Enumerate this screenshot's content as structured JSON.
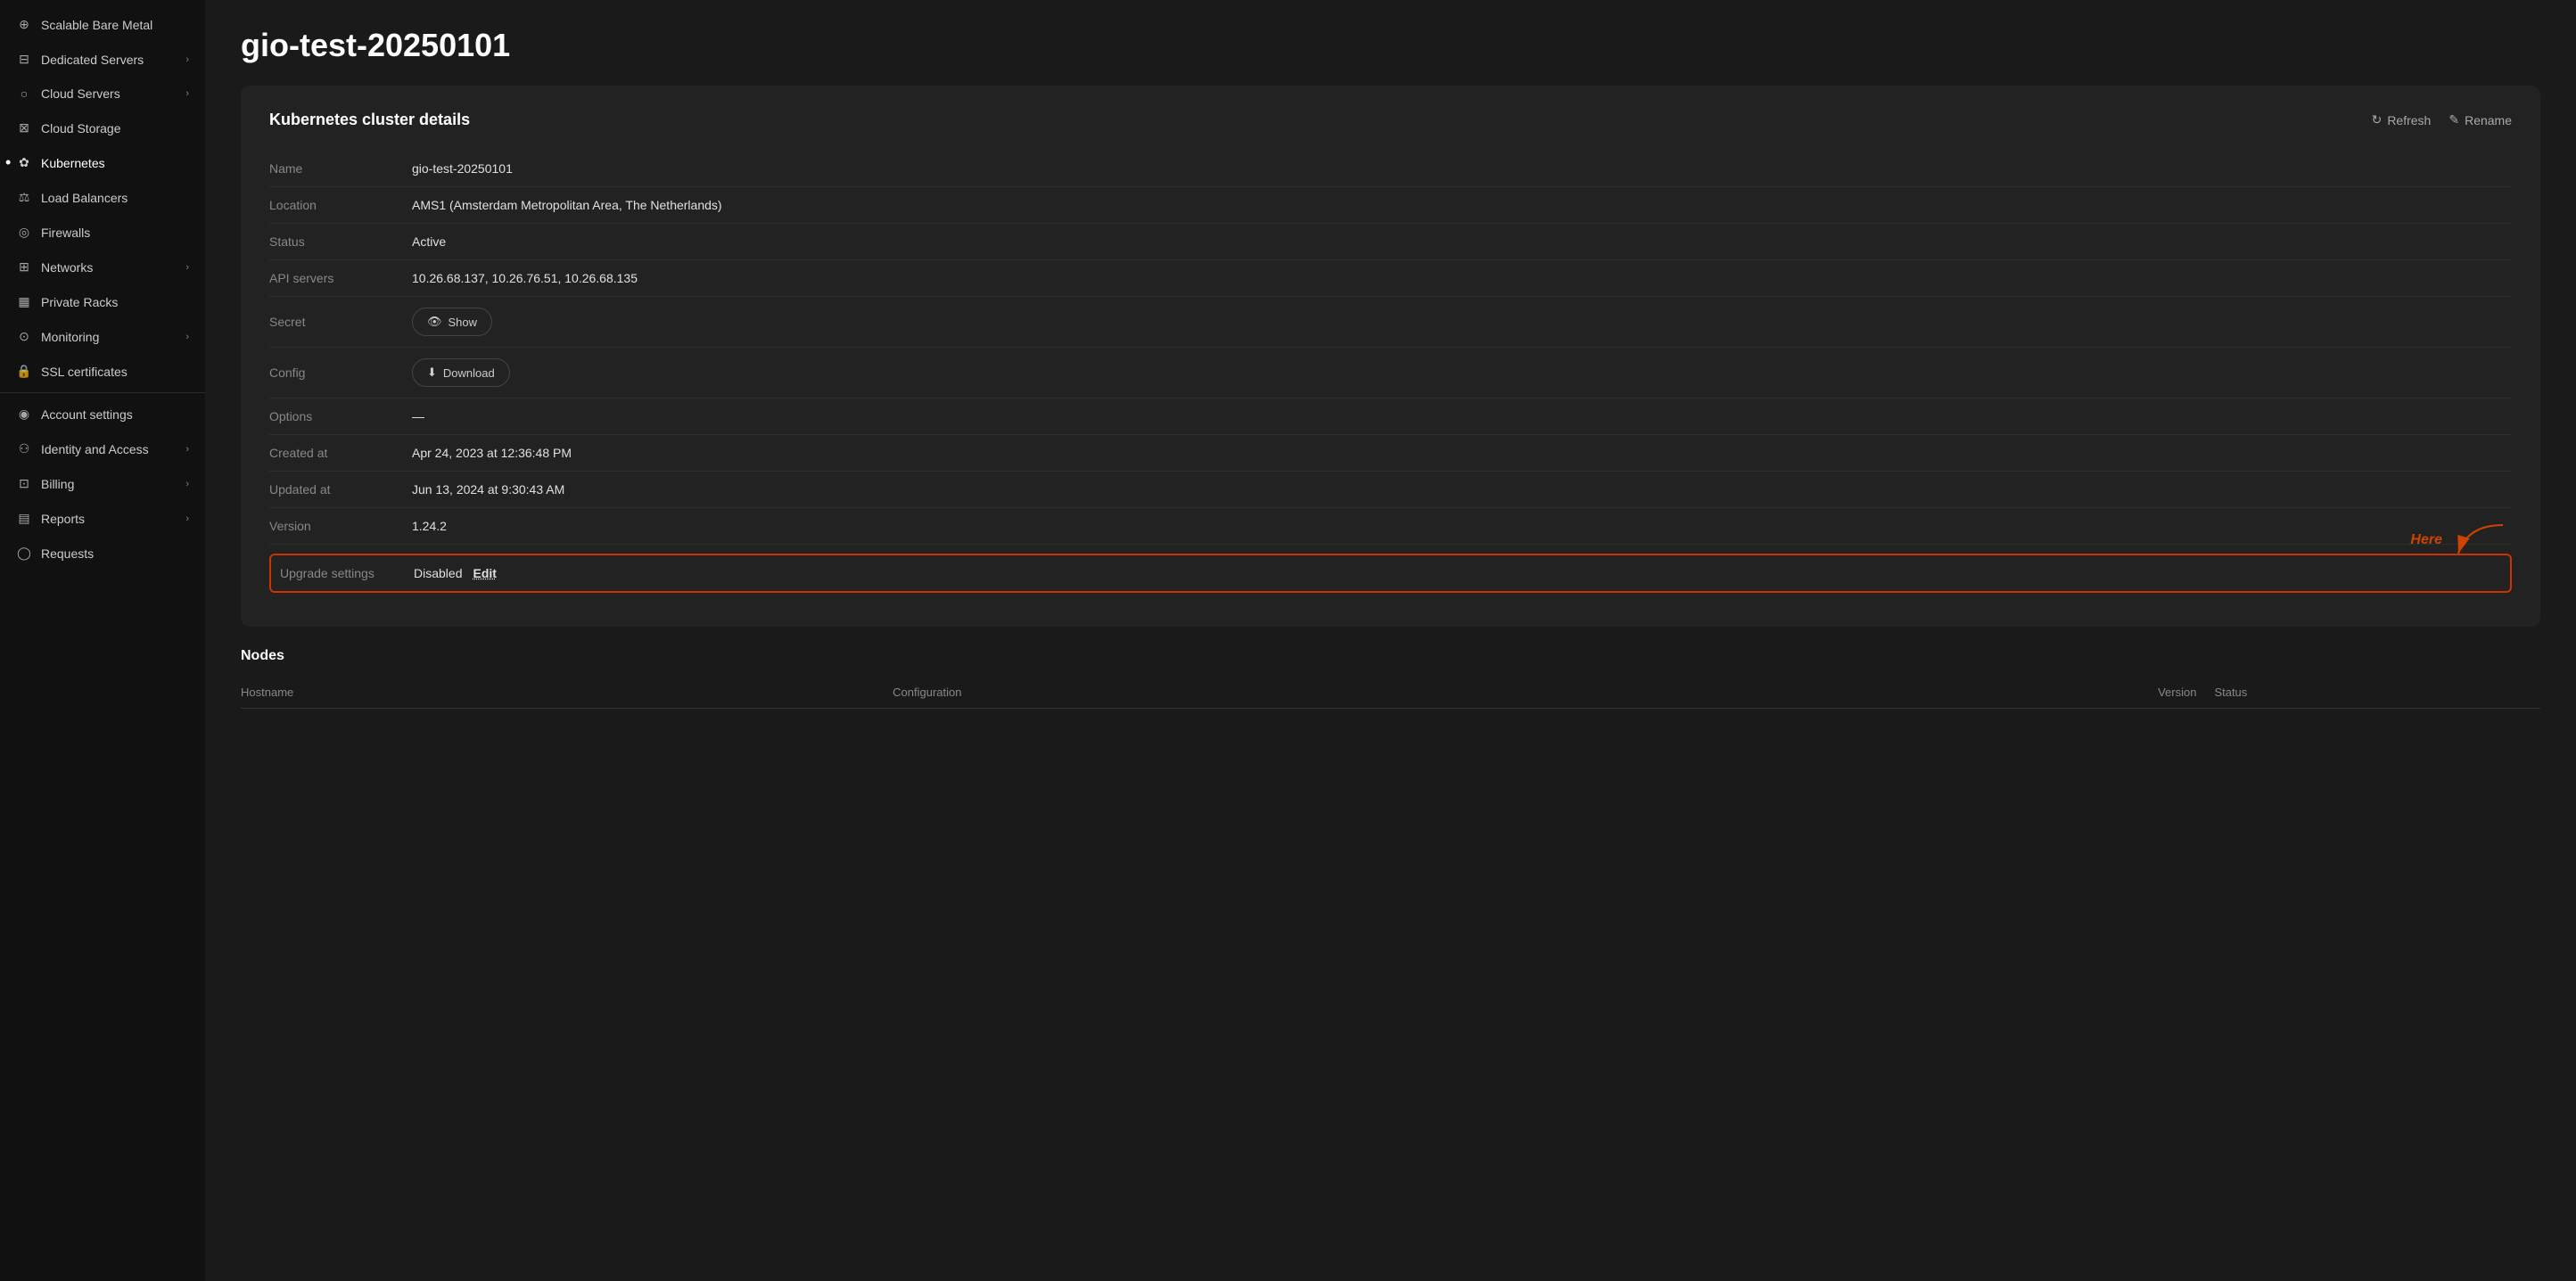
{
  "sidebar": {
    "items": [
      {
        "id": "scalable-bare-metal",
        "label": "Scalable Bare Metal",
        "icon": "⊕",
        "hasChevron": false,
        "active": false
      },
      {
        "id": "dedicated-servers",
        "label": "Dedicated Servers",
        "icon": "⊟",
        "hasChevron": true,
        "active": false
      },
      {
        "id": "cloud-servers",
        "label": "Cloud Servers",
        "icon": "○",
        "hasChevron": true,
        "active": false
      },
      {
        "id": "cloud-storage",
        "label": "Cloud Storage",
        "icon": "⊠",
        "hasChevron": false,
        "active": false
      },
      {
        "id": "kubernetes",
        "label": "Kubernetes",
        "icon": "✿",
        "hasChevron": false,
        "active": true
      },
      {
        "id": "load-balancers",
        "label": "Load Balancers",
        "icon": "⚖",
        "hasChevron": false,
        "active": false
      },
      {
        "id": "firewalls",
        "label": "Firewalls",
        "icon": "◎",
        "hasChevron": false,
        "active": false
      },
      {
        "id": "networks",
        "label": "Networks",
        "icon": "⊞",
        "hasChevron": true,
        "active": false
      },
      {
        "id": "private-racks",
        "label": "Private Racks",
        "icon": "▦",
        "hasChevron": false,
        "active": false
      },
      {
        "id": "monitoring",
        "label": "Monitoring",
        "icon": "⊙",
        "hasChevron": true,
        "active": false
      },
      {
        "id": "ssl-certificates",
        "label": "SSL certificates",
        "icon": "🔒",
        "hasChevron": false,
        "active": false
      },
      {
        "id": "account-settings",
        "label": "Account settings",
        "icon": "◉",
        "hasChevron": false,
        "active": false
      },
      {
        "id": "identity-and-access",
        "label": "Identity and Access",
        "icon": "⚇",
        "hasChevron": true,
        "active": false
      },
      {
        "id": "billing",
        "label": "Billing",
        "icon": "⊡",
        "hasChevron": true,
        "active": false
      },
      {
        "id": "reports",
        "label": "Reports",
        "icon": "▤",
        "hasChevron": true,
        "active": false
      },
      {
        "id": "requests",
        "label": "Requests",
        "icon": "◯",
        "hasChevron": false,
        "active": false
      }
    ]
  },
  "page": {
    "title": "gio-test-20250101"
  },
  "cluster_details": {
    "section_title": "Kubernetes cluster details",
    "refresh_label": "Refresh",
    "rename_label": "Rename",
    "fields": [
      {
        "label": "Name",
        "value": "gio-test-20250101"
      },
      {
        "label": "Location",
        "value": "AMS1 (Amsterdam Metropolitan Area, The Netherlands)"
      },
      {
        "label": "Status",
        "value": "Active"
      },
      {
        "label": "API servers",
        "value": "10.26.68.137, 10.26.76.51, 10.26.68.135"
      },
      {
        "label": "Secret",
        "value": null,
        "type": "show-button"
      },
      {
        "label": "Config",
        "value": null,
        "type": "download-button"
      },
      {
        "label": "Options",
        "value": "—"
      },
      {
        "label": "Created at",
        "value": "Apr 24, 2023 at 12:36:48 PM"
      },
      {
        "label": "Updated at",
        "value": "Jun 13, 2024 at 9:30:43 AM"
      },
      {
        "label": "Version",
        "value": "1.24.2"
      }
    ],
    "upgrade_settings": {
      "label": "Upgrade settings",
      "value": "Disabled",
      "edit_label": "Edit"
    },
    "annotation": {
      "text": "Here"
    },
    "show_button_label": "Show",
    "download_button_label": "Download"
  },
  "nodes": {
    "title": "Nodes",
    "columns": {
      "hostname": "Hostname",
      "configuration": "Configuration",
      "version": "Version",
      "status": "Status"
    }
  }
}
